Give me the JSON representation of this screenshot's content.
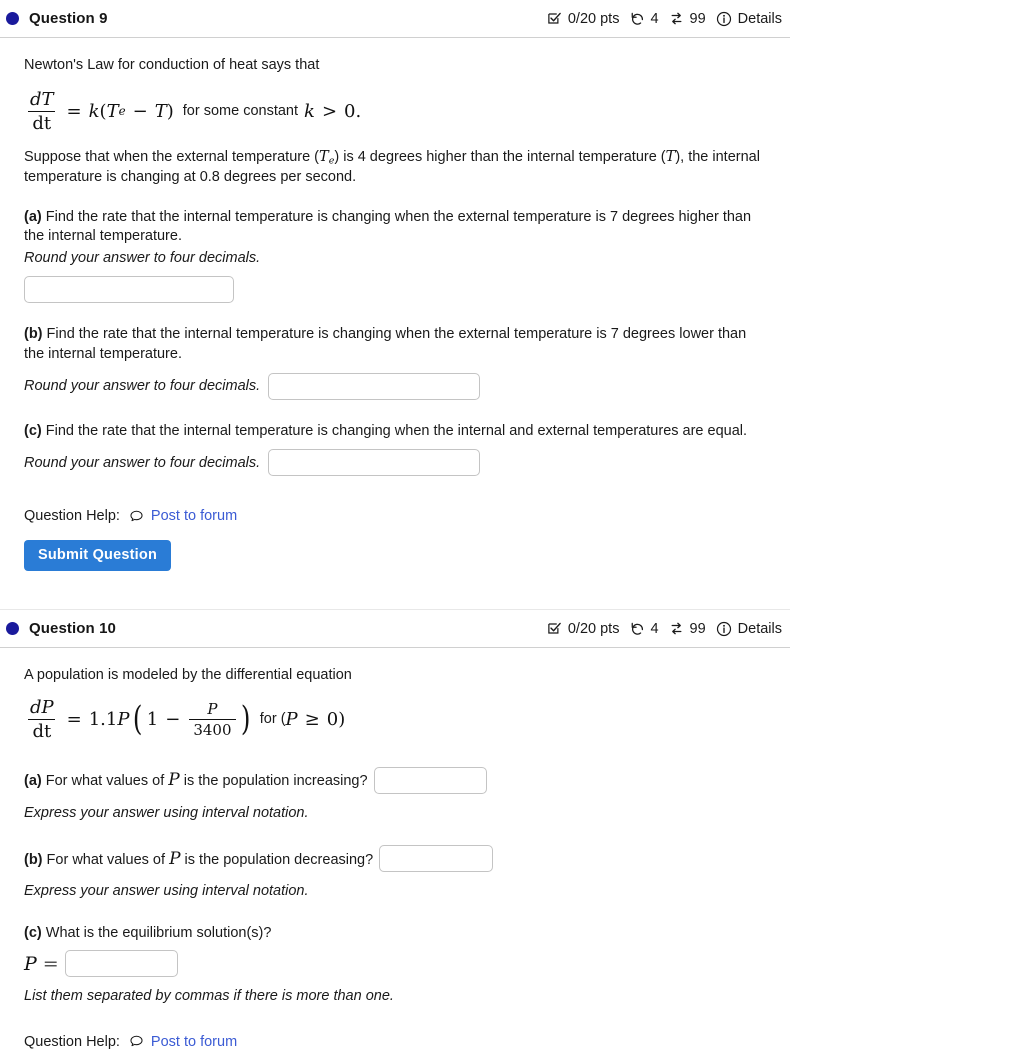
{
  "theme": {
    "dot_color": "#1a1a9c",
    "link_color": "#3b5bd4",
    "submit_bg": "#2a7cd6",
    "text_color": "#1a1a1a",
    "rule_color": "#d0d0d0"
  },
  "questions": [
    {
      "title": "Question 9",
      "meta": {
        "points": "0/20 pts",
        "attempts": "4",
        "versions": "99",
        "details_label": "Details",
        "icons": {
          "points": "checkbox-check-icon",
          "attempts": "undo-rewind-icon",
          "versions": "swap-arrows-icon",
          "details": "info-circle-icon"
        }
      },
      "intro": "Newton's Law for conduction of heat says that",
      "formula": {
        "lhs_num": "dT",
        "lhs_den": "dt",
        "equals": "=",
        "k": "k",
        "open_paren": "(",
        "Te_base": "T",
        "Te_sub": "e",
        "minus": "−",
        "T": "T",
        "close_paren": ")",
        "tail_text": "for some constant",
        "tail_k": "k",
        "tail_rel": ">",
        "tail_zero": "0."
      },
      "supposition": {
        "part1": "Suppose that when the external temperature (",
        "var_Te_base": "T",
        "var_Te_sub": "e",
        "part2": ") is 4 degrees higher than the internal temperature (",
        "var_T": "T",
        "part3": "), the internal temperature is changing at 0.8 degrees per second."
      },
      "parts": [
        {
          "label": "(a)",
          "text": "Find the rate that the internal temperature is changing when the external temperature is 7 degrees higher than the internal temperature.",
          "hint": "Round your answer to four decimals.",
          "layout": "hint-above",
          "input_value": "",
          "input_placeholder": ""
        },
        {
          "label": "(b)",
          "text": "Find the rate that the internal temperature is changing when the external temperature is 7 degrees lower than the internal temperature.",
          "hint": "Round your answer to four decimals.",
          "layout": "hint-inline",
          "input_value": "",
          "input_placeholder": ""
        },
        {
          "label": "(c)",
          "text": "Find the rate that the internal temperature is changing when the internal and external temperatures are equal.",
          "hint": "Round your answer to four decimals.",
          "layout": "hint-inline",
          "input_value": "",
          "input_placeholder": ""
        }
      ],
      "help_label": "Question Help:",
      "forum_link": "Post to forum",
      "submit_label": "Submit Question",
      "has_submit": true
    },
    {
      "title": "Question 10",
      "meta": {
        "points": "0/20 pts",
        "attempts": "4",
        "versions": "99",
        "details_label": "Details",
        "icons": {
          "points": "checkbox-check-icon",
          "attempts": "undo-rewind-icon",
          "versions": "swap-arrows-icon",
          "details": "info-circle-icon"
        }
      },
      "intro": "A population is modeled by the differential equation",
      "formula": {
        "lhs_num": "dP",
        "lhs_den": "dt",
        "equals": "=",
        "coef": "1.1",
        "P": "P",
        "one": "1",
        "minus": "−",
        "frac_num": "P",
        "frac_den": "3400",
        "tail_text": "for (",
        "tail_P": "P",
        "tail_rel": "≥",
        "tail_zero": "0)"
      },
      "parts": [
        {
          "label": "(a)",
          "text_before": "For what values of",
          "var": "P",
          "text_after": "is the population increasing?",
          "hint": "Express your answer using interval notation.",
          "input_value": "",
          "input_placeholder": ""
        },
        {
          "label": "(b)",
          "text_before": "For what values of",
          "var": "P",
          "text_after": "is the population decreasing?",
          "hint": "Express your answer using interval notation.",
          "input_value": "",
          "input_placeholder": ""
        }
      ],
      "part_c": {
        "label": "(c)",
        "text": "What is the equilibrium solution(s)?",
        "var": "P",
        "equals": "=",
        "hint": "List them separated by commas if there is more than one.",
        "input_value": "",
        "input_placeholder": ""
      },
      "help_label": "Question Help:",
      "forum_link": "Post to forum",
      "has_submit": false
    }
  ]
}
